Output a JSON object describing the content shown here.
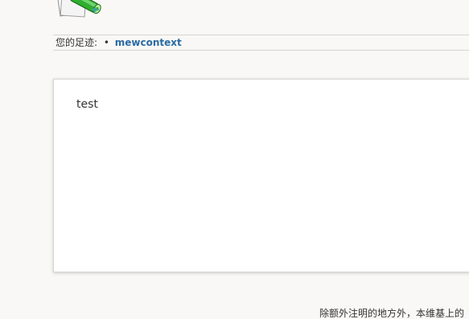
{
  "logo": {
    "icon": "wiki-scroll-logo-icon"
  },
  "breadcrumb": {
    "label": "您的足迹:",
    "separator": "•",
    "items": [
      {
        "label": "mewcontext"
      }
    ]
  },
  "content": {
    "text": "test"
  },
  "footer": {
    "text": "除额外注明的地方外，本维基上的"
  },
  "colors": {
    "background": "#f9f8f6",
    "link": "#2a6ba3",
    "panel": "#ffffff"
  }
}
